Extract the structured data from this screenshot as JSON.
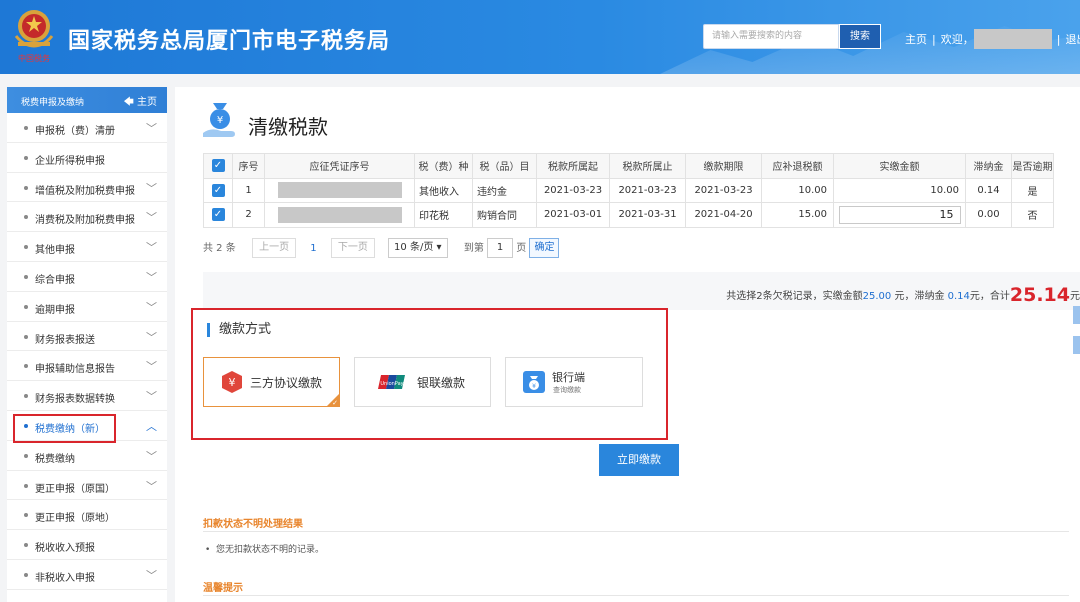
{
  "header": {
    "site_title": "国家税务总局厦门市电子税务局",
    "emblem_sub": "中国税务",
    "search_placeholder": "请输入需要搜索的内容",
    "search_button": "搜索",
    "nav_home": "主页",
    "welcome": "欢迎，",
    "logout": "退出"
  },
  "sidebar": {
    "title": "税费申报及缴纳",
    "home": "主页",
    "items": [
      {
        "label": "申报税（费）清册",
        "chevron": "down"
      },
      {
        "label": "企业所得税申报",
        "chevron": ""
      },
      {
        "label": "增值税及附加税费申报",
        "chevron": "down"
      },
      {
        "label": "消费税及附加税费申报",
        "chevron": "down"
      },
      {
        "label": "其他申报",
        "chevron": "down"
      },
      {
        "label": "综合申报",
        "chevron": "down"
      },
      {
        "label": "逾期申报",
        "chevron": "down"
      },
      {
        "label": "财务报表报送",
        "chevron": "down"
      },
      {
        "label": "申报辅助信息报告",
        "chevron": "down"
      },
      {
        "label": "财务报表数据转换",
        "chevron": "down"
      },
      {
        "label": "税费缴纳（新）",
        "chevron": "up",
        "active": true
      },
      {
        "label": "税费缴纳",
        "chevron": "down"
      },
      {
        "label": "更正申报（原国）",
        "chevron": "down"
      },
      {
        "label": "更正申报（原地）",
        "chevron": ""
      },
      {
        "label": "税收收入预报",
        "chevron": ""
      },
      {
        "label": "非税收入申报",
        "chevron": "down"
      }
    ]
  },
  "main": {
    "page_title": "清缴税款",
    "table": {
      "headers": [
        "",
        "序号",
        "应征凭证序号",
        "税（费）种",
        "税（品）目",
        "税款所属起",
        "税款所属止",
        "缴款期限",
        "应补退税额",
        "实缴金额",
        "滞纳金",
        "是否逾期"
      ],
      "rows": [
        {
          "checked": true,
          "no": "1",
          "tax_type": "其他收入",
          "item": "违约金",
          "start": "2021-03-23",
          "end": "2021-03-23",
          "deadline": "2021-03-23",
          "due": "10.00",
          "paid": "10.00",
          "late_fee": "0.14",
          "overdue": "是",
          "editable": false
        },
        {
          "checked": true,
          "no": "2",
          "tax_type": "印花税",
          "item": "购销合同",
          "start": "2021-03-01",
          "end": "2021-03-31",
          "deadline": "2021-04-20",
          "due": "15.00",
          "paid": "15",
          "late_fee": "0.00",
          "overdue": "否",
          "editable": true
        }
      ]
    },
    "pager": {
      "total": "共 2 条",
      "prev": "上一页",
      "current": "1",
      "next": "下一页",
      "page_size": "10 条/页",
      "goto": "到第",
      "goto_value": "1",
      "page_unit": "页",
      "confirm": "确定"
    },
    "summary": {
      "p1": "共选择2条欠税记录，实缴金额",
      "paid": "25.00",
      "p2": " 元，滞纳金 ",
      "late": "0.14",
      "p3": "元，合计",
      "total": "25.14",
      "p4": "元"
    },
    "payment": {
      "title": "缴款方式",
      "options": [
        {
          "label": "三方协议缴款",
          "selected": true
        },
        {
          "label": "银联缴款",
          "selected": false
        },
        {
          "label": "银行端",
          "sub": "查询缴款",
          "selected": false
        }
      ],
      "pay_now": "立即缴款"
    },
    "deduct": {
      "title": "扣款状态不明处理结果",
      "message": "您无扣款状态不明的记录。"
    },
    "tips": {
      "title": "温馨提示"
    }
  },
  "colors": {
    "brand_blue": "#2a86dc",
    "highlight_red": "#d9252c",
    "selected_orange": "#e8923d",
    "unionpay_red": "#d9252c",
    "bank_blue": "#3a8ee6"
  }
}
